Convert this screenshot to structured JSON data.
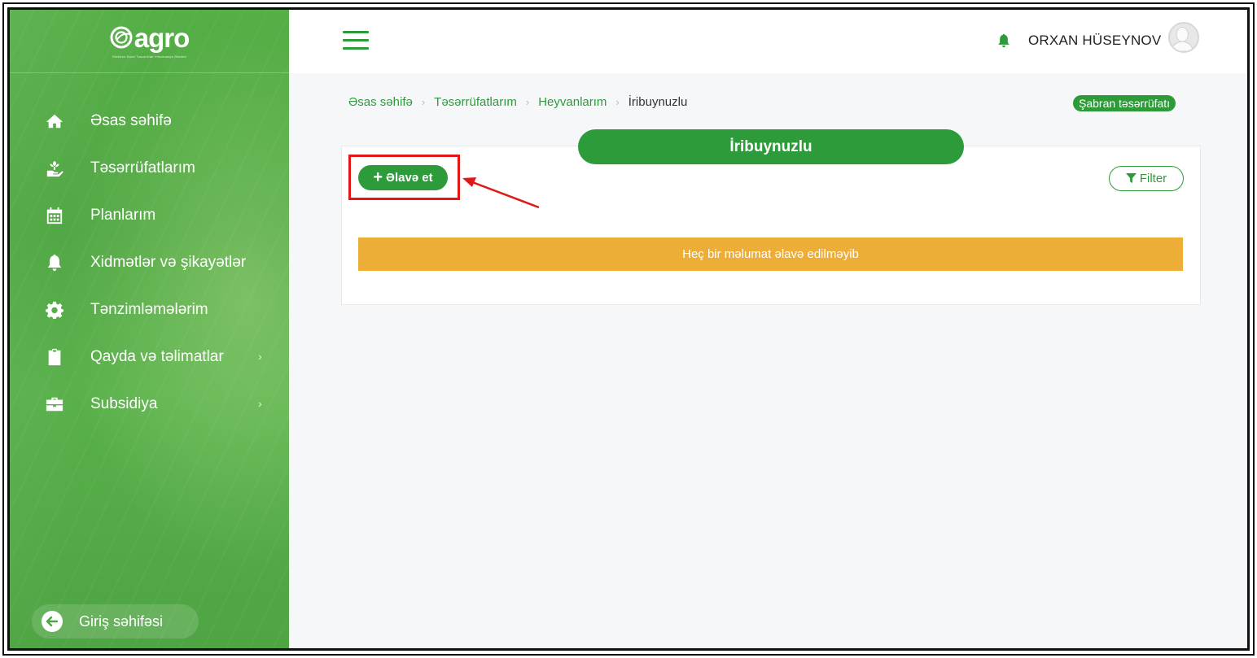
{
  "sidebar": {
    "logo_text": "agro",
    "logo_subtitle": "Elektron Kənd Təsərrüfatı İnformasiya Sistemi",
    "items": [
      {
        "label": "Əsas səhifə",
        "icon": "home-icon"
      },
      {
        "label": "Təsərrüfatlarım",
        "icon": "farm-icon"
      },
      {
        "label": "Planlarım",
        "icon": "calendar-icon"
      },
      {
        "label": "Xidmətlər və şikayətlər",
        "icon": "bell-icon"
      },
      {
        "label": "Tənzimləmələrim",
        "icon": "gear-icon"
      },
      {
        "label": "Qayda və təlimatlar",
        "icon": "clipboard-icon",
        "chevron": "›"
      },
      {
        "label": "Subsidiya",
        "icon": "briefcase-icon",
        "chevron": "›"
      }
    ],
    "login_label": "Giriş səhifəsi"
  },
  "header": {
    "user_name": "ORXAN HÜSEYNOV"
  },
  "breadcrumb": {
    "items": [
      "Əsas səhifə",
      "Təsərrüfatlarım",
      "Heyvanlarım"
    ],
    "current": "İribuynuzlu",
    "separator": "›"
  },
  "farm_badge": "Şabran təsərrüfatı",
  "page": {
    "title": "İribuynuzlu",
    "add_label": "Əlavə et",
    "add_plus": "+",
    "filter_label": "Filter",
    "empty_message": "Heç bir məlumat əlavə edilməyib"
  },
  "colors": {
    "primary": "#2e9b3a",
    "warning": "#ecae36",
    "highlight": "#e01818"
  }
}
